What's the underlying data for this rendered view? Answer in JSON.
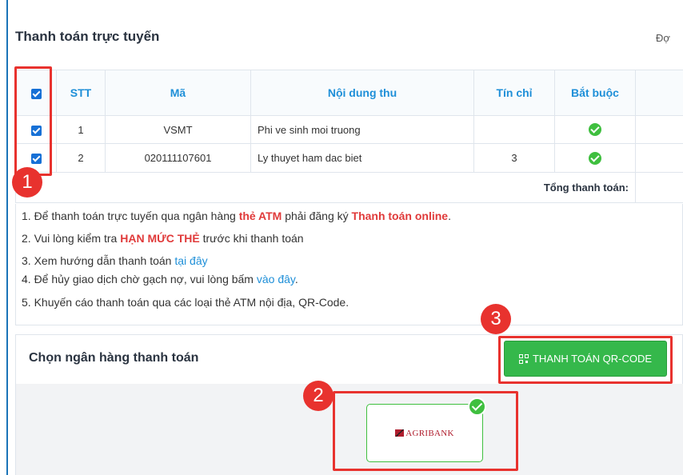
{
  "panel": {
    "title": "Thanh toán trực tuyến",
    "title_right": "Đợ"
  },
  "table": {
    "headers": [
      "STT",
      "Mã",
      "Nội dung thu",
      "Tín chỉ",
      "Bắt buộc"
    ],
    "rows": [
      {
        "stt": "1",
        "ma": "VSMT",
        "noi_dung": "Phi ve sinh moi truong",
        "tin_chi": "",
        "bat_buoc": true
      },
      {
        "stt": "2",
        "ma": "020111107601",
        "noi_dung": "Ly thuyet ham dac biet",
        "tin_chi": "3",
        "bat_buoc": true
      }
    ],
    "total_label": "Tổng thanh toán:"
  },
  "notes": {
    "n1_a": "1. Để thanh toán trực tuyến qua ngân hàng ",
    "n1_b": "thẻ ATM",
    "n1_c": " phải đăng ký ",
    "n1_d": "Thanh toán online",
    "n1_e": ".",
    "n2_a": "2. Vui lòng kiểm tra ",
    "n2_b": "HẠN MỨC THẺ",
    "n2_c": " trước khi thanh toán",
    "n3_a": "3. Xem hướng dẫn thanh toán ",
    "n3_link": "tại đây",
    "n4_a": "4. Để hủy giao dịch chờ gạch nợ, vui lòng bấm ",
    "n4_link": "vào đây",
    "n4_b": ".",
    "n5": "5. Khuyến cáo thanh toán qua các loại thẻ ATM nội địa, QR-Code."
  },
  "bank": {
    "title": "Chọn ngân hàng thanh toán",
    "qr_button": "THANH TOÁN QR-CODE",
    "selected_bank": "AGRIBANK"
  },
  "annotations": {
    "badge1": "1",
    "badge2": "2",
    "badge3": "3",
    "color": "#e8322e"
  },
  "colors": {
    "header_text": "#1e8fd8",
    "accent_green": "#35b84b",
    "warning_red": "#e03a3a",
    "checkbox_blue": "#1670d6"
  }
}
